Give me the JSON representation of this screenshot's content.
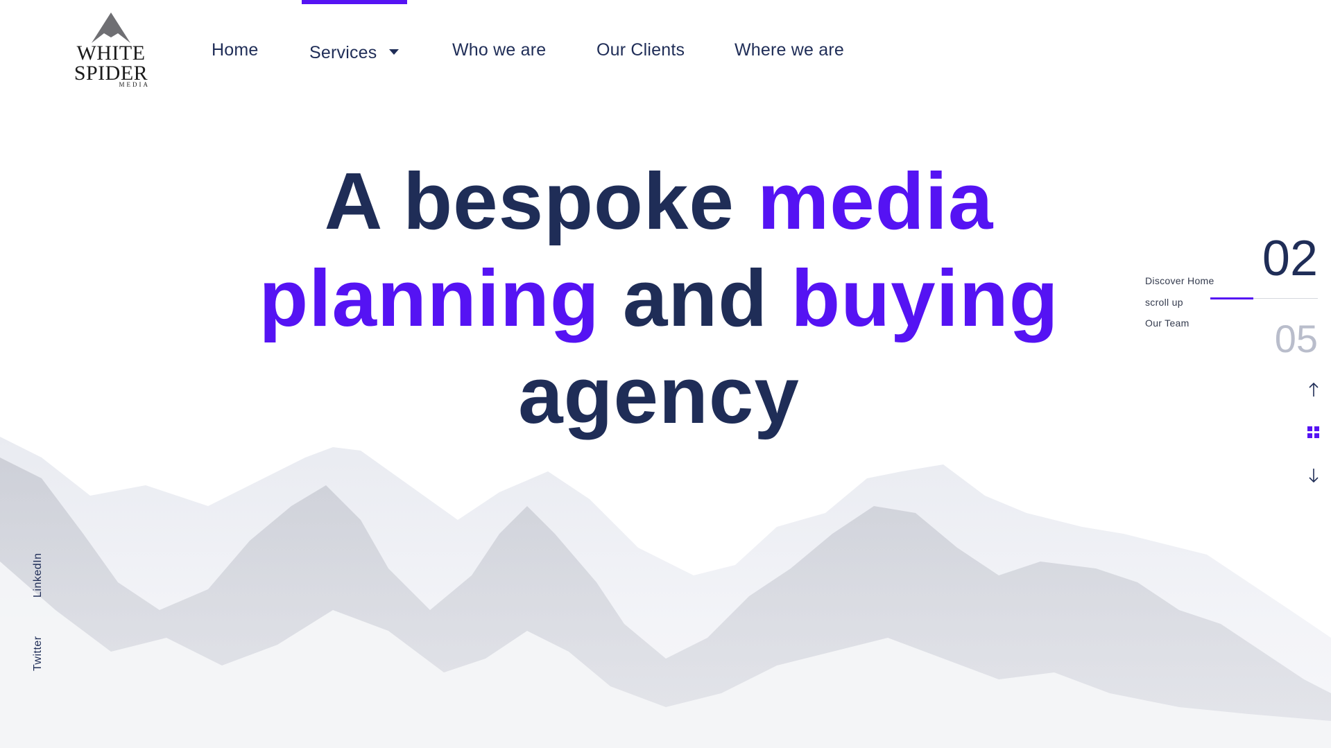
{
  "logo": {
    "line1": "WHITE",
    "line2": "SPIDER",
    "line3": "MEDIA"
  },
  "nav": {
    "items": [
      {
        "label": "Home"
      },
      {
        "label": "Services"
      },
      {
        "label": "Who we are"
      },
      {
        "label": "Our Clients"
      },
      {
        "label": "Where we are"
      }
    ],
    "active_index": 1
  },
  "hero": {
    "w1": "A bespoke",
    "w2": "media",
    "w3": "planning",
    "w4": "and",
    "w5": "buying",
    "w6": "agency"
  },
  "section_nav": {
    "current": "02",
    "total": "05",
    "prev_label": "Discover Home",
    "action_label": "scroll up",
    "next_label": "Our Team",
    "progress": 0.4,
    "controls": [
      "arrow-up-icon",
      "grid-icon",
      "arrow-down-icon"
    ]
  },
  "social": {
    "items": [
      {
        "label": "LinkedIn"
      },
      {
        "label": "Twitter"
      }
    ]
  },
  "colors": {
    "accent": "#5513f3",
    "navy": "#1f2d57",
    "muted": "#b9bdcb"
  }
}
